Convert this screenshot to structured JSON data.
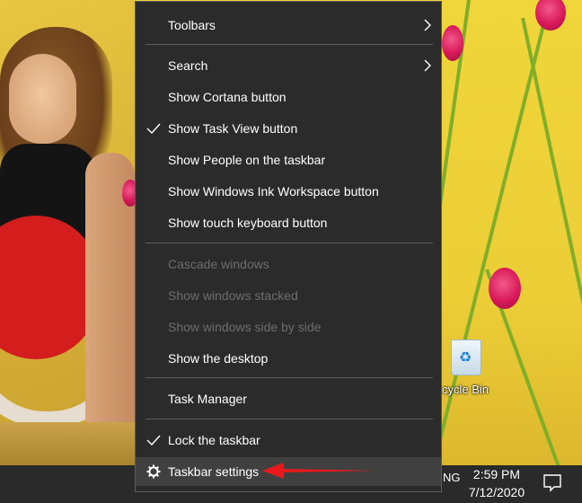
{
  "context_menu": {
    "items": [
      {
        "label": "Toolbars",
        "submenu": true
      },
      {
        "label": "Search",
        "submenu": true
      },
      {
        "label": "Show Cortana button"
      },
      {
        "label": "Show Task View button",
        "checked": true
      },
      {
        "label": "Show People on the taskbar"
      },
      {
        "label": "Show Windows Ink Workspace button"
      },
      {
        "label": "Show touch keyboard button"
      },
      {
        "label": "Cascade windows",
        "disabled": true
      },
      {
        "label": "Show windows stacked",
        "disabled": true
      },
      {
        "label": "Show windows side by side",
        "disabled": true
      },
      {
        "label": "Show the desktop"
      },
      {
        "label": "Task Manager"
      },
      {
        "label": "Lock the taskbar",
        "checked": true
      },
      {
        "label": "Taskbar settings",
        "icon": "gear-icon"
      }
    ]
  },
  "desktop": {
    "recycle_bin_label": "cycle Bin"
  },
  "taskbar": {
    "language": "NG",
    "time": "2:59 PM",
    "date": "7/12/2020"
  },
  "colors": {
    "menu_background": "#2b2b2b",
    "menu_text": "#ffffff",
    "menu_disabled_text": "#6d6d6d",
    "annotation_arrow": "#e8191c",
    "taskbar": "#2a2a2a"
  }
}
